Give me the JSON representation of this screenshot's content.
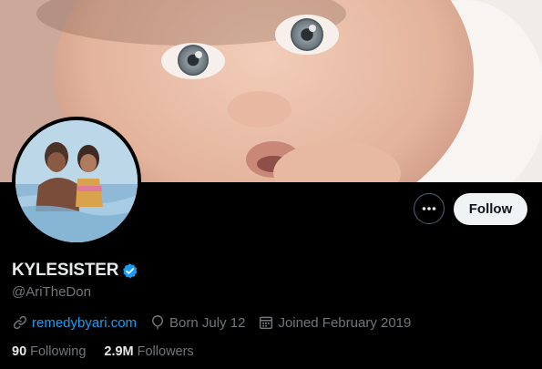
{
  "profile": {
    "display_name": "KYLESISTER",
    "handle": "@AriTheDon",
    "website": "remedybyari.com",
    "birthday": "Born July 12",
    "joined": "Joined February 2019"
  },
  "actions": {
    "follow_label": "Follow",
    "more_icon": "more-options-icon"
  },
  "stats": {
    "following_count": "90",
    "following_label": "Following",
    "followers_count": "2.9M",
    "followers_label": "Followers"
  },
  "icons": {
    "verified": "verified-badge-icon",
    "link": "link-icon",
    "birthday": "balloon-icon",
    "joined": "calendar-icon"
  },
  "colors": {
    "background": "#000000",
    "accent": "#1d9bf0",
    "primary_text": "#e7e9ea",
    "secondary_text": "#71767b",
    "follow_button_bg": "#eff3f4"
  }
}
